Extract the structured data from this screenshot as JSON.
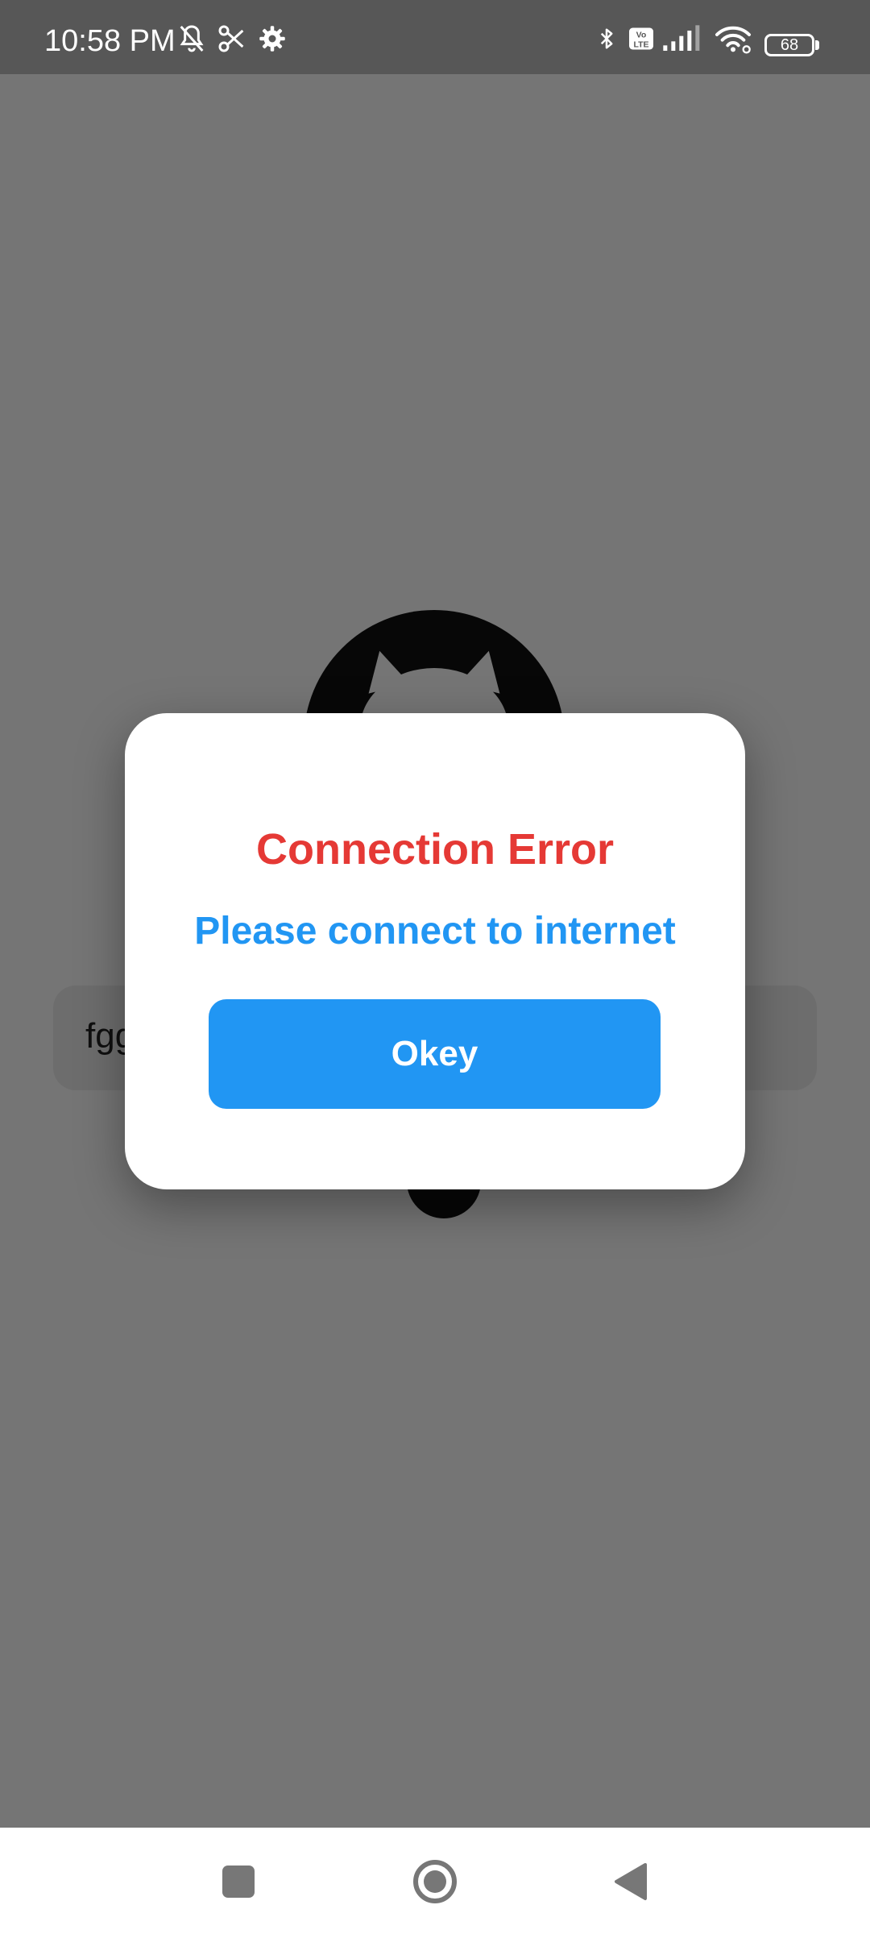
{
  "status_bar": {
    "time": "10:58 PM",
    "battery_level": "68",
    "left_icons": [
      "muted-bell-icon",
      "scissors-icon",
      "gear-icon"
    ],
    "right_icons": [
      "bluetooth-icon",
      "volte-icon",
      "cellular-signal-icon",
      "wifi-icon",
      "battery-icon"
    ],
    "volte_label": "Vo LTE"
  },
  "background_app": {
    "text_field_value": "fgg",
    "logo_icon": "github-octocat-icon"
  },
  "dialog": {
    "title": "Connection Error",
    "message": "Please connect to internet",
    "button_label": "Okey",
    "colors": {
      "title": "#e53935",
      "message": "#2196f3",
      "button": "#2196f3"
    }
  },
  "nav_bar": {
    "icons": [
      "recents-square-icon",
      "home-circle-icon",
      "back-triangle-icon"
    ]
  }
}
